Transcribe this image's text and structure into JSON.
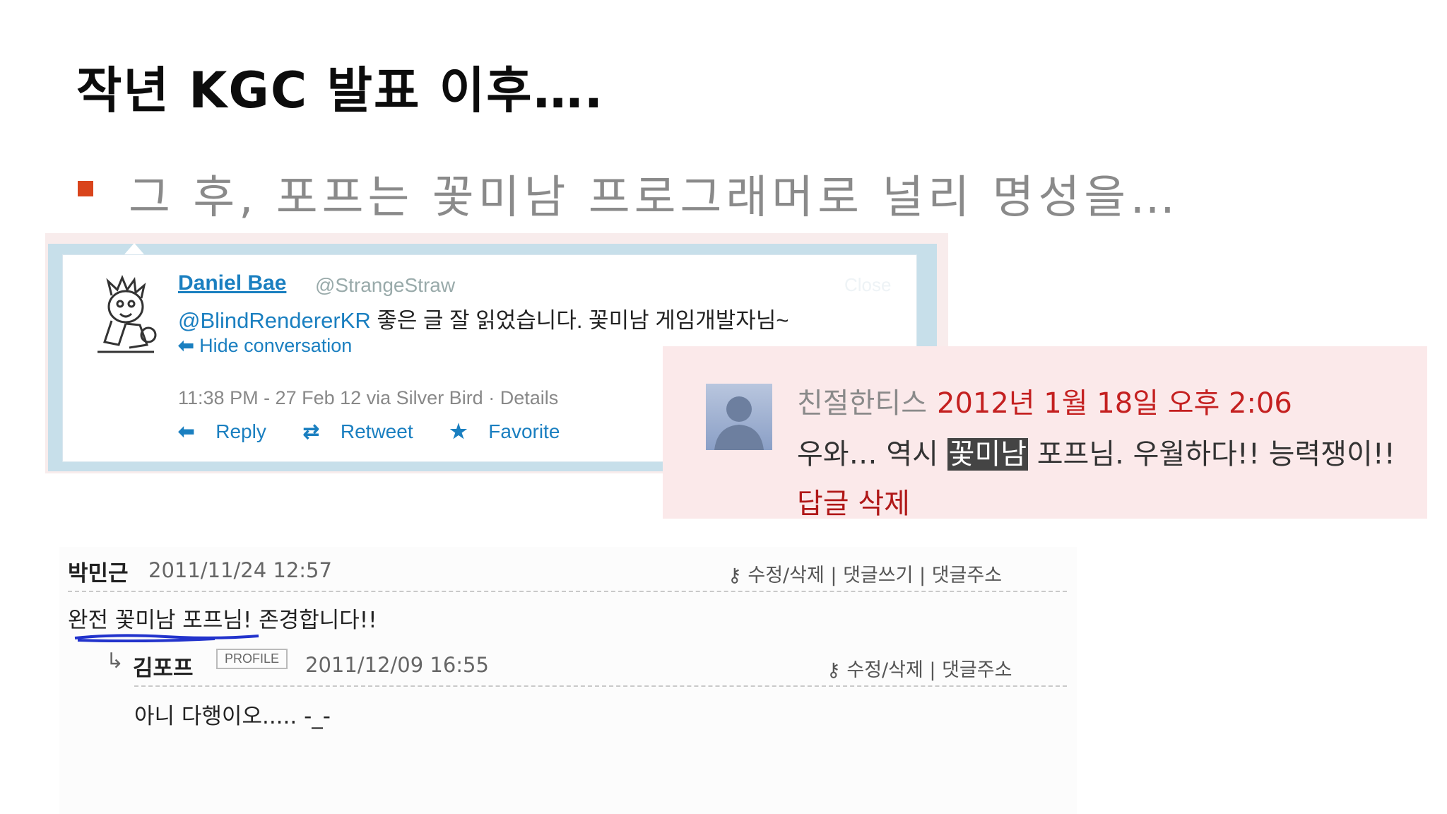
{
  "slide": {
    "title": "작년 KGC 발표 이후….",
    "bullet": "그 후, 포프는 꽃미남 프로그래머로 널리 명성을…"
  },
  "tweet": {
    "name": "Daniel Bae",
    "handle": "@StrangeStraw",
    "close_label": "Close",
    "mention": "@BlindRendererKR",
    "text": " 좋은 글 잘 읽었습니다. 꽃미남 게임개발자님~",
    "hide_conversation": "Hide conversation",
    "meta": "11:38 PM - 27 Feb 12 via Silver Bird · Details",
    "reply": "Reply",
    "retweet": "Retweet",
    "favorite": "Favorite"
  },
  "pink_comment": {
    "author": "친절한티스",
    "date": "2012년 1월 18일 오후 2:06",
    "body_before": "우와… 역시 ",
    "highlight": "꽃미남",
    "body_after": " 포프님. 우월하다!! 능력쟁이!!",
    "links": "답글 삭제"
  },
  "blog": {
    "comment": {
      "author": "박민근",
      "date": "2011/11/24 12:57",
      "tools": "수정/삭제 | 댓글쓰기 | 댓글주소",
      "text": "완전 꽃미남 포프님! 존경합니다!!"
    },
    "reply": {
      "arrow": "↳",
      "author": "김포프",
      "badge": "PROFILE",
      "date": "2011/12/09 16:55",
      "tools": "수정/삭제 | 댓글주소",
      "text": "아니 다행이오..... -_-"
    }
  },
  "colors": {
    "bullet": "#d9441c",
    "twitter_blue": "#1a7fc0",
    "pink_bg": "#fbe9ea",
    "date_red": "#c42020"
  }
}
